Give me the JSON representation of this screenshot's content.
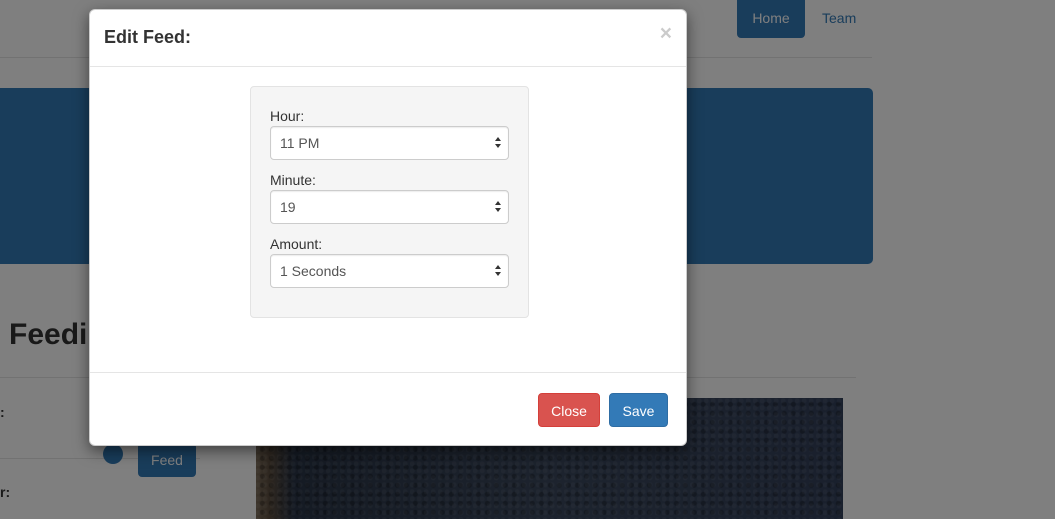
{
  "nav": {
    "home_label": "Home",
    "team_label": "Team"
  },
  "background": {
    "heading": "Feedi",
    "label_1": ":",
    "label_2": "r:",
    "feed_button_label": "Feed"
  },
  "modal": {
    "title": "Edit Feed:",
    "close_glyph": "×",
    "fields": [
      {
        "label": "Hour:",
        "value": "11 PM"
      },
      {
        "label": "Minute:",
        "value": "19"
      },
      {
        "label": "Amount:",
        "value": "1 Seconds"
      }
    ],
    "close_button_label": "Close",
    "save_button_label": "Save"
  },
  "colors": {
    "primary": "#337ab7",
    "danger": "#d9534f",
    "well": "#f5f5f5"
  }
}
